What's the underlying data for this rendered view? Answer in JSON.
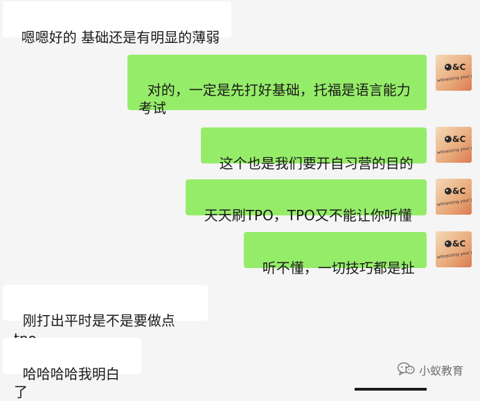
{
  "messages": [
    {
      "side": "in",
      "text": "嗯嗯好的 基础还是有明显的薄弱"
    },
    {
      "side": "out",
      "text": "对的，一定是先打好基础，托福是语言能力考试"
    },
    {
      "side": "out",
      "text": "这个也是我们要开自习营的目的"
    },
    {
      "side": "out",
      "text": "天天刷TPO，TPO又不能让你听懂"
    },
    {
      "side": "out",
      "text": "听不懂，一切技巧都是扯"
    },
    {
      "side": "in",
      "text": "刚打出平时是不是要做点tpo"
    },
    {
      "side": "in",
      "text": "哈哈哈哈我明白了"
    }
  ],
  "avatar": {
    "logo_text": "A&C",
    "tagline": "witnessing your progress",
    "icon": "brand-logo-avatar"
  },
  "watermark": {
    "icon": "wechat-official-account-icon",
    "text": "小蚁教育"
  },
  "colors": {
    "background": "#f5f5f5",
    "incoming_bubble": "#ffffff",
    "outgoing_bubble": "#95ec69",
    "text": "#1a1a1a"
  }
}
